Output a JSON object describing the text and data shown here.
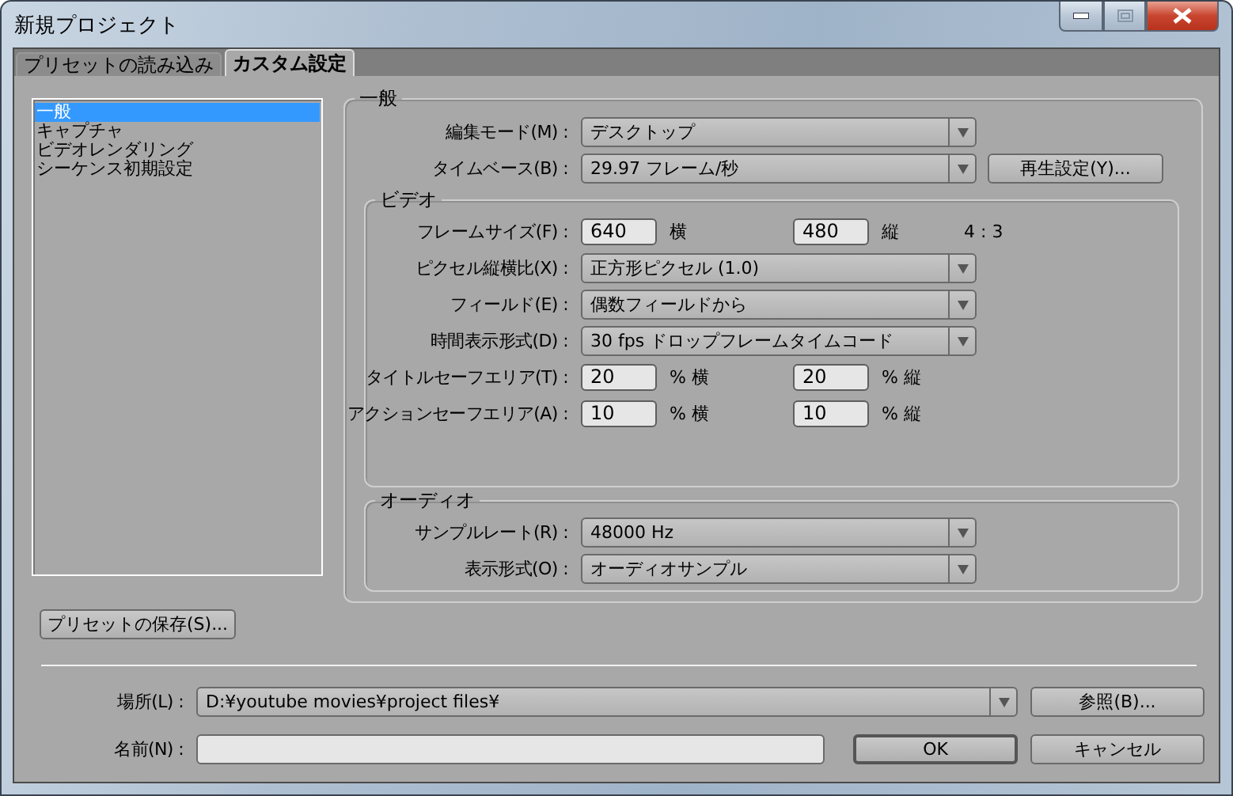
{
  "window": {
    "title": "新規プロジェクト"
  },
  "tabs": [
    {
      "label": "プリセットの読み込み",
      "selected": false
    },
    {
      "label": "カスタム設定",
      "selected": true
    }
  ],
  "sidebar": {
    "items": [
      {
        "label": "一般",
        "selected": true
      },
      {
        "label": "キャプチャ",
        "selected": false
      },
      {
        "label": "ビデオレンダリング",
        "selected": false
      },
      {
        "label": "シーケンス初期設定",
        "selected": false
      }
    ]
  },
  "general": {
    "title": "一般",
    "rows": [
      {
        "kind": "dropdown",
        "label": "編集モード(M) :",
        "value": "デスクトップ"
      },
      {
        "kind": "dropdown",
        "label": "タイムベース(B) :",
        "value": "29.97 フレーム/秒",
        "button": "再生設定(Y)..."
      }
    ]
  },
  "video": {
    "title": "ビデオ",
    "rows": [
      {
        "kind": "pair",
        "label": "フレームサイズ(F) :",
        "first": "640",
        "first_unit": "横",
        "second": "480",
        "second_unit": "縦",
        "note": "4 : 3"
      },
      {
        "kind": "dropdown",
        "label": "ピクセル縦横比(X) :",
        "value": "正方形ピクセル (1.0)"
      },
      {
        "kind": "dropdown",
        "label": "フィールド(E) :",
        "value": "偶数フィールドから"
      },
      {
        "kind": "dropdown",
        "label": "時間表示形式(D) :",
        "value": "30 fps ドロップフレームタイムコード"
      },
      {
        "kind": "pair",
        "label": "タイトルセーフエリア(T) :",
        "first": "20",
        "first_unit": "% 横",
        "second": "20",
        "second_unit": "% 縦"
      },
      {
        "kind": "pair",
        "label": "アクションセーフエリア(A) :",
        "first": "10",
        "first_unit": "% 横",
        "second": "10",
        "second_unit": "% 縦"
      }
    ]
  },
  "audio": {
    "title": "オーディオ",
    "rows": [
      {
        "kind": "dropdown",
        "label": "サンプルレート(R) :",
        "value": "48000 Hz"
      },
      {
        "kind": "dropdown",
        "label": "表示形式(O) :",
        "value": "オーディオサンプル"
      }
    ]
  },
  "save_preset_button": "プリセットの保存(S)...",
  "location": {
    "label": "場所(L) :",
    "value": "D:¥youtube movies¥project files¥",
    "button": "参照(B)..."
  },
  "name": {
    "label": "名前(N) :"
  },
  "ok_button": "OK",
  "cancel_button": "キャンセル"
}
